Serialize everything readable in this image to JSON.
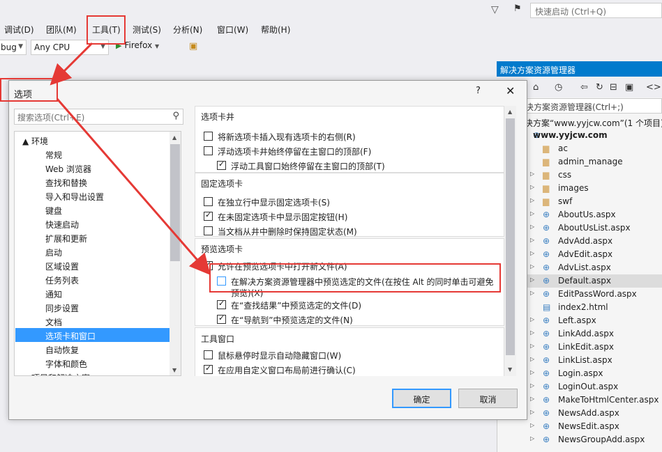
{
  "titlebar": {
    "quick_launch_placeholder": "快速启动 (Ctrl+Q)"
  },
  "menu": [
    "调试(D)",
    "团队(M)",
    "工具(T)",
    "测试(S)",
    "分析(N)",
    "窗口(W)",
    "帮助(H)"
  ],
  "toolbar": {
    "config": "bug",
    "platform": "Any CPU",
    "browser": "Firefox"
  },
  "solution_explorer": {
    "title": "解决方案资源管理器",
    "search_placeholder": "决方案资源管理器(Ctrl+;)",
    "items": [
      {
        "label": "决方案“www.yyjcw.com”(1 个项目)",
        "type": "solution"
      },
      {
        "label": "www.yyjcw.com",
        "type": "project"
      },
      {
        "label": "ac",
        "type": "folder"
      },
      {
        "label": "admin_manage",
        "type": "folder"
      },
      {
        "label": "css",
        "type": "folder"
      },
      {
        "label": "images",
        "type": "folder"
      },
      {
        "label": "swf",
        "type": "folder"
      },
      {
        "label": "AboutUs.aspx",
        "type": "page"
      },
      {
        "label": "AboutUsList.aspx",
        "type": "page"
      },
      {
        "label": "AdvAdd.aspx",
        "type": "page"
      },
      {
        "label": "AdvEdit.aspx",
        "type": "page"
      },
      {
        "label": "AdvList.aspx",
        "type": "page"
      },
      {
        "label": "Default.aspx",
        "type": "page",
        "selected": true
      },
      {
        "label": "EditPassWord.aspx",
        "type": "page"
      },
      {
        "label": "index2.html",
        "type": "html"
      },
      {
        "label": "Left.aspx",
        "type": "page"
      },
      {
        "label": "LinkAdd.aspx",
        "type": "page"
      },
      {
        "label": "LinkEdit.aspx",
        "type": "page"
      },
      {
        "label": "LinkList.aspx",
        "type": "page"
      },
      {
        "label": "Login.aspx",
        "type": "page"
      },
      {
        "label": "LoginOut.aspx",
        "type": "page"
      },
      {
        "label": "MakeToHtmlCenter.aspx",
        "type": "page"
      },
      {
        "label": "NewsAdd.aspx",
        "type": "page"
      },
      {
        "label": "NewsEdit.aspx",
        "type": "page"
      },
      {
        "label": "NewsGroupAdd.aspx",
        "type": "page"
      }
    ]
  },
  "dialog": {
    "title": "选项",
    "help": "?",
    "search_placeholder": "搜索选项(Ctrl+E)",
    "tree": [
      {
        "label": "▲  环境",
        "level": 0
      },
      {
        "label": "常规",
        "level": 1
      },
      {
        "label": "Web 浏览器",
        "level": 1
      },
      {
        "label": "查找和替换",
        "level": 1
      },
      {
        "label": "导入和导出设置",
        "level": 1
      },
      {
        "label": "键盘",
        "level": 1
      },
      {
        "label": "快速启动",
        "level": 1
      },
      {
        "label": "扩展和更新",
        "level": 1
      },
      {
        "label": "启动",
        "level": 1
      },
      {
        "label": "区域设置",
        "level": 1
      },
      {
        "label": "任务列表",
        "level": 1
      },
      {
        "label": "通知",
        "level": 1
      },
      {
        "label": "同步设置",
        "level": 1
      },
      {
        "label": "文档",
        "level": 1
      },
      {
        "label": "选项卡和窗口",
        "level": 1,
        "selected": true
      },
      {
        "label": "自动恢复",
        "level": 1
      },
      {
        "label": "字体和颜色",
        "level": 1
      },
      {
        "label": "▷  项目和解决方案",
        "level": 0
      }
    ],
    "groups": [
      {
        "title": "选项卡井",
        "options": [
          {
            "label": "将新选项卡插入现有选项卡的右侧(R)",
            "checked": false,
            "indent": 0
          },
          {
            "label": "浮动选项卡井始终停留在主窗口的顶部(F)",
            "checked": false,
            "indent": 0
          },
          {
            "label": "浮动工具窗口始终停留在主窗口的顶部(T)",
            "checked": true,
            "indent": 1
          }
        ]
      },
      {
        "title": "固定选项卡",
        "options": [
          {
            "label": "在独立行中显示固定选项卡(S)",
            "checked": false,
            "indent": 0
          },
          {
            "label": "在未固定选项卡中显示固定按钮(H)",
            "checked": true,
            "indent": 0
          },
          {
            "label": "当文档从井中删除时保持固定状态(M)",
            "checked": false,
            "indent": 0
          }
        ]
      },
      {
        "title": "预览选项卡",
        "options": [
          {
            "label": "允许在预览选项卡中打开新文件(A)",
            "checked": true,
            "indent": 0
          },
          {
            "label": "在解决方案资源管理器中预览选定的文件(在按住 Alt 的同时单击可避免",
            "label2": "预览)(X)",
            "checked": false,
            "indent": 1,
            "highlighted": true
          },
          {
            "label": "在“查找结果”中预览选定的文件(D)",
            "checked": true,
            "indent": 1
          },
          {
            "label": "在“导航到”中预览选定的文件(N)",
            "checked": true,
            "indent": 1
          }
        ]
      },
      {
        "title": "工具窗口",
        "options": [
          {
            "label": "鼠标悬停时显示自动隐藏窗口(W)",
            "checked": false,
            "indent": 0
          },
          {
            "label": "在应用自定义窗口布局前进行确认(C)",
            "checked": true,
            "indent": 0
          }
        ]
      }
    ],
    "ok": "确定",
    "cancel": "取消"
  },
  "annotation_color": "#e53935",
  "accent_color": "#007acc",
  "selection_color": "#3399ff"
}
